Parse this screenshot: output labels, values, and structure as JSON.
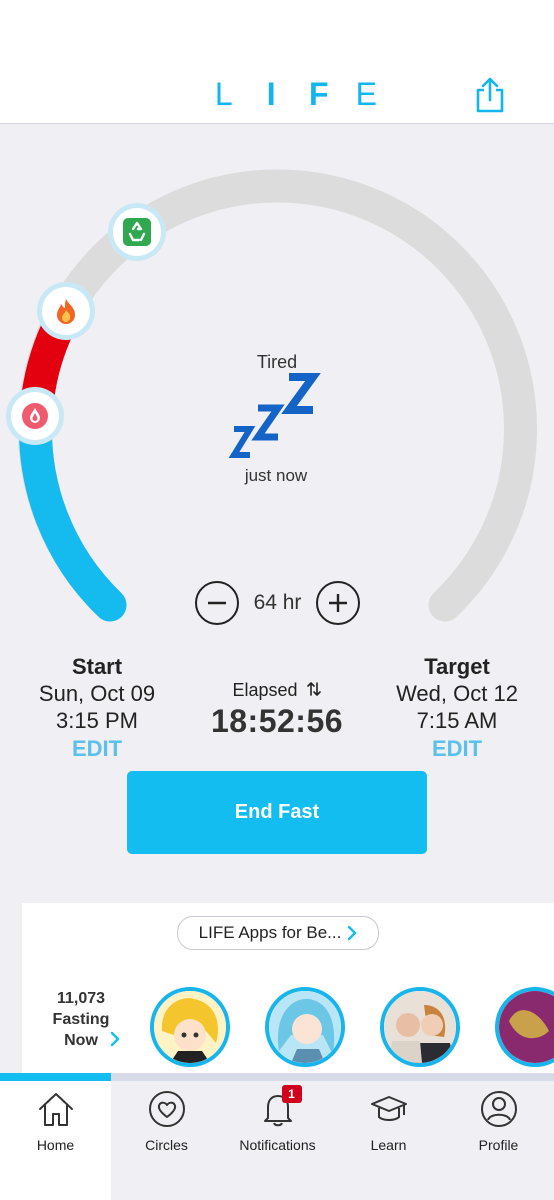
{
  "header": {
    "logo_letters": [
      "L",
      "I",
      "F",
      "E"
    ],
    "share_icon": "share-icon",
    "accent_color": "#12b6ee"
  },
  "gauge": {
    "status_label": "Tired",
    "status_icon": "zzz-sleep-icon",
    "status_time": "just now",
    "badges": [
      "recycle-icon",
      "flame-icon",
      "drop-icon"
    ],
    "stepper_value": "64 hr",
    "progress_color": "#13bdf0",
    "phase_color": "#e3000f"
  },
  "start": {
    "title": "Start",
    "date": "Sun, Oct 09",
    "time": "3:15 PM",
    "edit": "EDIT"
  },
  "elapsed": {
    "label": "Elapsed",
    "sort_icon": "swap-arrows-icon",
    "value": "18:52:56"
  },
  "target": {
    "title": "Target",
    "date": "Wed, Oct 12",
    "time": "7:15 AM",
    "edit": "EDIT"
  },
  "end_button": "End Fast",
  "apps": {
    "pill_label": "LIFE Apps for Be...",
    "fasting_count": "11,073",
    "fasting_line2": "Fasting",
    "fasting_line3": "Now"
  },
  "tabs": [
    {
      "label": "Home",
      "icon": "home-icon"
    },
    {
      "label": "Circles",
      "icon": "heart-circle-icon"
    },
    {
      "label": "Notifications",
      "icon": "bell-icon",
      "badge": "1"
    },
    {
      "label": "Learn",
      "icon": "graduation-cap-icon"
    },
    {
      "label": "Profile",
      "icon": "person-icon"
    }
  ]
}
